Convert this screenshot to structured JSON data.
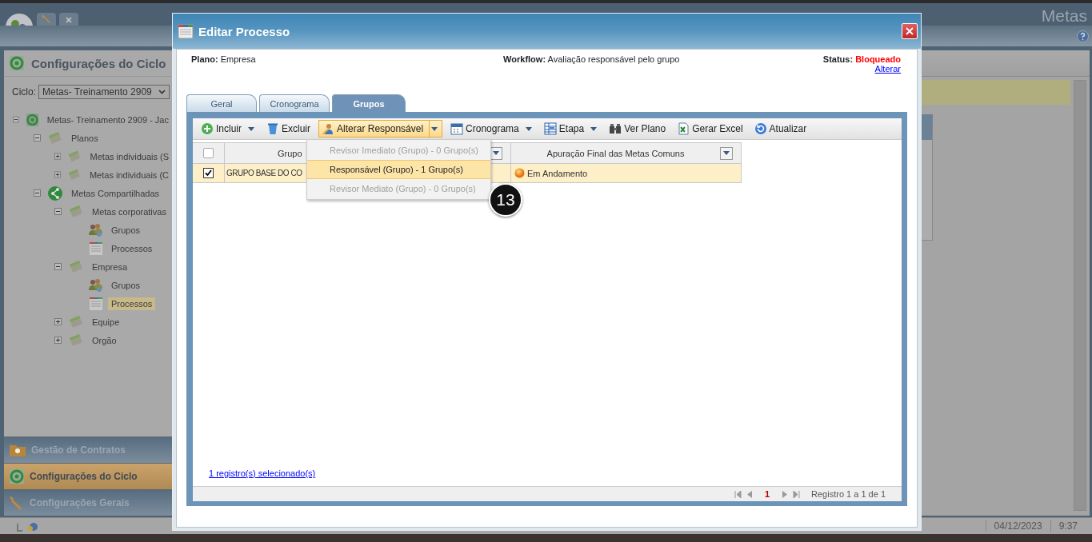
{
  "app": {
    "title": "Metas"
  },
  "sidebar": {
    "title": "Configurações do Ciclo",
    "cycle_label": "Ciclo:",
    "cycle_value": "Metas- Treinamento 2909",
    "tree": [
      {
        "label": "Metas- Treinamento 2909 - Jac",
        "kind": "cycle",
        "expanded": true,
        "selected": false,
        "children": [
          {
            "label": "Planos",
            "kind": "plan",
            "expanded": true,
            "selected": false,
            "children": [
              {
                "label": "Metas individuais (S",
                "kind": "plan",
                "expanded": false,
                "selected": false
              },
              {
                "label": "Metas individuais (C",
                "kind": "plan",
                "expanded": false,
                "selected": false
              }
            ]
          },
          {
            "label": "Metas Compartilhadas",
            "kind": "shared",
            "expanded": true,
            "selected": false,
            "children": [
              {
                "label": "Metas corporativas",
                "kind": "plan",
                "expanded": true,
                "selected": false,
                "children": [
                  {
                    "label": "Grupos",
                    "kind": "group",
                    "selected": false
                  },
                  {
                    "label": "Processos",
                    "kind": "process",
                    "selected": false
                  }
                ]
              },
              {
                "label": "Empresa",
                "kind": "plan",
                "expanded": true,
                "selected": false,
                "children": [
                  {
                    "label": "Grupos",
                    "kind": "group",
                    "selected": false
                  },
                  {
                    "label": "Processos",
                    "kind": "process",
                    "selected": true
                  }
                ]
              },
              {
                "label": "Equipe",
                "kind": "plan",
                "expanded": false,
                "selected": false
              },
              {
                "label": "Orgão",
                "kind": "plan",
                "expanded": false,
                "selected": false
              }
            ]
          }
        ]
      }
    ],
    "sections": [
      {
        "label": "Gestão de Contratos",
        "kind": "contracts",
        "selected": false
      },
      {
        "label": "Configurações do Ciclo",
        "kind": "cycle",
        "selected": true
      },
      {
        "label": "Configurações Gerais",
        "kind": "tools",
        "selected": false
      }
    ]
  },
  "status_bar": {
    "date": "04/12/2023",
    "time": "9:37"
  },
  "dialog": {
    "title": "Editar Processo",
    "plan_label": "Plano:",
    "plan_value": "Empresa",
    "workflow_label": "Workflow:",
    "workflow_value": "Avaliação responsável pelo grupo",
    "status_label": "Status:",
    "status_value": "Bloqueado",
    "status_link": "Alterar",
    "tabs": [
      {
        "label": "Geral",
        "selected": false
      },
      {
        "label": "Cronograma",
        "selected": false
      },
      {
        "label": "Grupos",
        "selected": true
      }
    ],
    "toolbar": [
      {
        "label": "Incluir",
        "kind": "add",
        "menu": true,
        "pressed": false
      },
      {
        "label": "Excluir",
        "kind": "trash",
        "menu": false,
        "pressed": false
      },
      {
        "label": "Alterar Responsável",
        "kind": "person",
        "menu": true,
        "pressed": true
      },
      {
        "label": "Cronograma",
        "kind": "calendar",
        "menu": true,
        "pressed": false
      },
      {
        "label": "Etapa",
        "kind": "steps",
        "menu": true,
        "pressed": false
      },
      {
        "label": "Ver Plano",
        "kind": "binoculars",
        "menu": false,
        "pressed": false
      },
      {
        "label": "Gerar Excel",
        "kind": "excel",
        "menu": false,
        "pressed": false
      },
      {
        "label": "Atualizar",
        "kind": "refresh",
        "menu": false,
        "pressed": false
      }
    ],
    "header_checkbox": {
      "checked": false
    },
    "columns": [
      {
        "label": "Grupo"
      },
      {
        "label": "Apuração Final das Metas Comuns"
      }
    ],
    "rows": [
      {
        "checked": true,
        "group": "GRUPO BASE DO CO",
        "status": "Em Andamento"
      }
    ],
    "menu": [
      {
        "label": "Revisor Imediato (Grupo) - 0 Grupo(s)",
        "disabled": true,
        "selected": false
      },
      {
        "label": "Responsável (Grupo) - 1 Grupo(s)",
        "disabled": false,
        "selected": true
      },
      {
        "label": "Revisor Mediato (Grupo) - 0 Grupo(s)",
        "disabled": true,
        "selected": false
      }
    ],
    "step_badge": "13",
    "selection_link": "1 registro(s) selecionado(s)",
    "pager": {
      "page": "1",
      "summary": "Registro 1 a 1 de 1"
    }
  }
}
